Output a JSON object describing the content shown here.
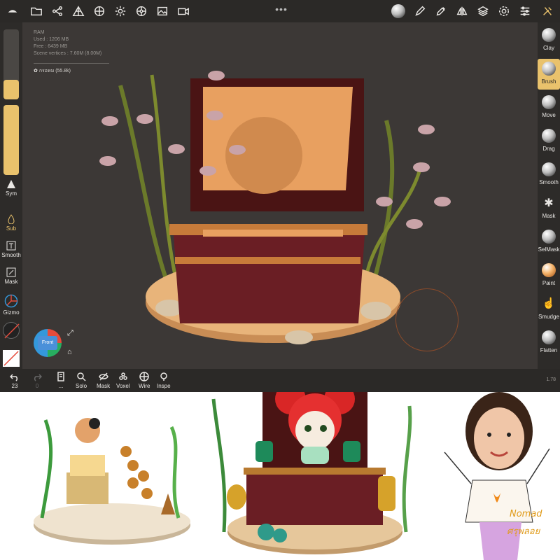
{
  "stats": {
    "ram_label": "RAM",
    "used": "Used : 1206 MB",
    "free": "Free : 6439 MB",
    "vertices": "Scene vertices : 7.60M (8.00M)"
  },
  "object": {
    "label": "กรอหม (55.8k)"
  },
  "left_tools": {
    "sym": "Sym",
    "sub": "Sub",
    "smooth": "Smooth",
    "mask": "Mask",
    "gizmo": "Gizmo"
  },
  "right_tools": {
    "clay": "Clay",
    "brush": "Brush",
    "move": "Move",
    "drag": "Drag",
    "smooth": "Smooth",
    "mask": "Mask",
    "selmask": "SelMask",
    "paint": "Paint",
    "smudge": "Smudge",
    "flatten": "Flatten"
  },
  "bottom": {
    "undo_count": "23",
    "redo_count": "0",
    "solo": "Solo",
    "mask": "Mask",
    "voxel": "Voxel",
    "wire": "Wire",
    "inspect": "Inspe",
    "zoom": "1.78"
  },
  "gizmo": {
    "face": "Front"
  },
  "signature": {
    "line1": "Nomad",
    "line2": "ศรุพลอย"
  },
  "colors": {
    "accent": "#e9c26c",
    "bg": "#3c3836",
    "panel": "#2b2927"
  }
}
